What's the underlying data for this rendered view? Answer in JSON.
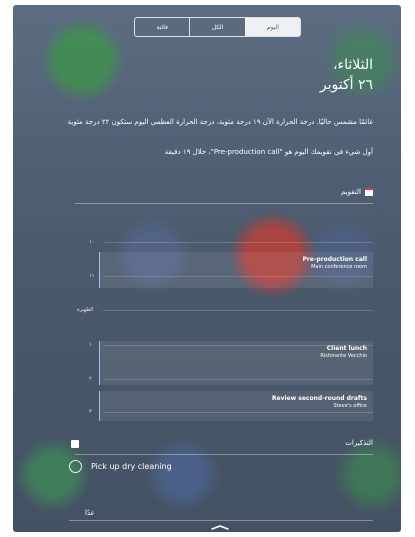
{
  "segmented_control": {
    "tabs": [
      "فائتة",
      "الكل",
      "اليوم"
    ],
    "selected": "اليوم"
  },
  "header": {
    "weekday": "الثلاثاء،",
    "date": "٢٦ أكتوبر"
  },
  "summary": {
    "weather": "غائمًا مشمس حاليًا. درجة الحرارة الآن ١٩ درجة مئوية، درجة الحرارة العظمى اليوم ستكون ٢٢ درجة مئوية",
    "first_event": "أول شيء في تقويمك اليوم هو \"Pre-production call\"، خلال ١٩ دقيقة"
  },
  "calendar": {
    "section_title": "التقويم",
    "hours": [
      "١٠",
      "١١",
      "الظهيرة",
      "١",
      "٢",
      "٣"
    ],
    "events": [
      {
        "title": "Pre-production call",
        "location": "Main conference room"
      },
      {
        "title": "Client lunch",
        "location": "Ristorante Vecchio"
      },
      {
        "title": "Review second-round drafts",
        "location": "Steve's office"
      }
    ]
  },
  "reminders": {
    "section_title": "التذكيرات",
    "items": [
      {
        "label": "Pick up dry cleaning"
      }
    ]
  },
  "tomorrow": {
    "label": "غدًا"
  },
  "colors": {
    "accent": "#52637a",
    "calendar_icon": "#e33333"
  }
}
